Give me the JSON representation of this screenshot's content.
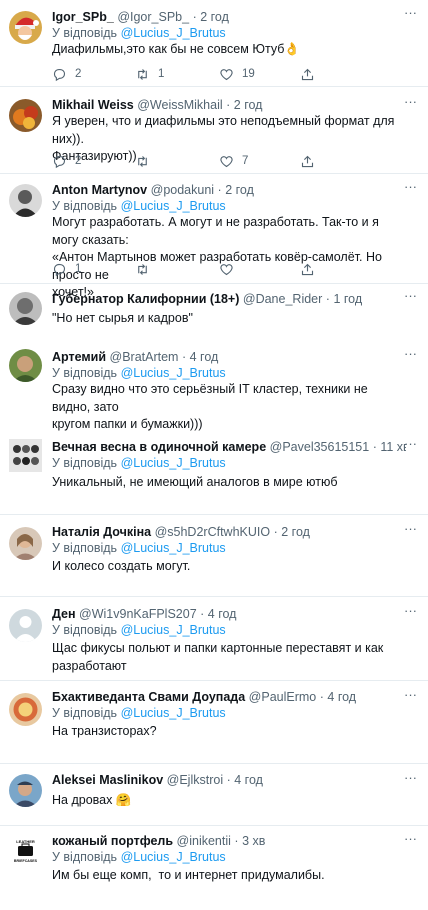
{
  "reply_prefix": "У відповідь",
  "dot": "·",
  "tweets": [
    {
      "name": "Igor_SPb_",
      "handle": "@Igor_SPb_",
      "time": "2 год",
      "reply_to": "@Lucius_J_Brutus",
      "text": "Диафильмы,это как бы не совсем Ютуб👌",
      "replies": "2",
      "retweets": "1",
      "likes": "19",
      "avatar": "santa-avatar"
    },
    {
      "name": "Mikhail Weiss",
      "handle": "@WeissMikhail",
      "time": "2 год",
      "reply_to": "",
      "text": "Я уверен, что и диафильмы это неподъемный формат для них)).\nФантазируют))",
      "replies": "2",
      "retweets": "",
      "likes": "7",
      "avatar": "fruit-avatar"
    },
    {
      "name": "Anton Martynov",
      "handle": "@podakuni",
      "time": "2 год",
      "reply_to": "@Lucius_J_Brutus",
      "text": "Могут разработать. А могут и не разработать. Так-то и я могу сказать:\n«Антон Мартынов может разработать ковёр-самолёт. Но просто не\nхочет!»",
      "replies": "1",
      "retweets": "",
      "likes": "",
      "avatar": "bw-portrait-avatar"
    },
    {
      "name": "Губернатор Калифорнии (18+)",
      "handle": "@Dane_Rider",
      "time": "1 год",
      "reply_to": "",
      "text": "\"Но нет сырья и кадров\"",
      "replies": "",
      "retweets": "",
      "likes": "",
      "avatar": "bw-face-avatar"
    },
    {
      "name": "Артемий",
      "handle": "@BratArtem",
      "time": "4 год",
      "reply_to": "@Lucius_J_Brutus",
      "text": "Сразу видно что это серьёзный IT кластер, техники не видно, зато\nкругом папки и бумажки)))",
      "replies": "",
      "retweets": "",
      "likes": "",
      "avatar": "green-face-avatar"
    },
    {
      "name": "Вечная весна в одиночной камере",
      "handle": "@Pavel35615151",
      "time": "11 хв",
      "reply_to": "@Lucius_J_Brutus",
      "text": "Уникальный, не имеющий аналогов в мире ютюб",
      "replies": "",
      "retweets": "",
      "likes": "",
      "avatar": "group-photo-avatar"
    },
    {
      "name": "Наталія Дочкіна",
      "handle": "@s5hD2rCftwhKUIO",
      "time": "2 год",
      "reply_to": "@Lucius_J_Brutus",
      "text": "И колесо создать могут.",
      "replies": "",
      "retweets": "",
      "likes": "",
      "avatar": "woman-avatar"
    },
    {
      "name": "Ден",
      "handle": "@Wi1v9nKaFPlS207",
      "time": "4 год",
      "reply_to": "@Lucius_J_Brutus",
      "text": "Щас фикусы польют и папки картонные переставят и как разработают",
      "replies": "",
      "retweets": "",
      "likes": "",
      "avatar": "default-user-avatar"
    },
    {
      "name": "Бхактиведанта Свами Доупада",
      "handle": "@PaulErmo",
      "time": "4 год",
      "reply_to": "@Lucius_J_Brutus",
      "text": "На транзисторах?",
      "replies": "",
      "retweets": "",
      "likes": "",
      "avatar": "icon-art-avatar"
    },
    {
      "name": "Aleksei Maslinikov",
      "handle": "@Ejlkstroi",
      "time": "4 год",
      "reply_to": "",
      "text": "На дровах 🤗",
      "replies": "",
      "retweets": "",
      "likes": "",
      "avatar": "man-cap-avatar"
    },
    {
      "name": "кожаный портфель",
      "handle": "@inikentii",
      "time": "3 хв",
      "reply_to": "@Lucius_J_Brutus",
      "text": "Им бы еще комп,  то и интернет придумалибы.",
      "replies": "",
      "retweets": "",
      "likes": "",
      "avatar": "briefcase-logo-avatar",
      "avatar_text": "LEATHER\nBRIEFCASES"
    }
  ]
}
